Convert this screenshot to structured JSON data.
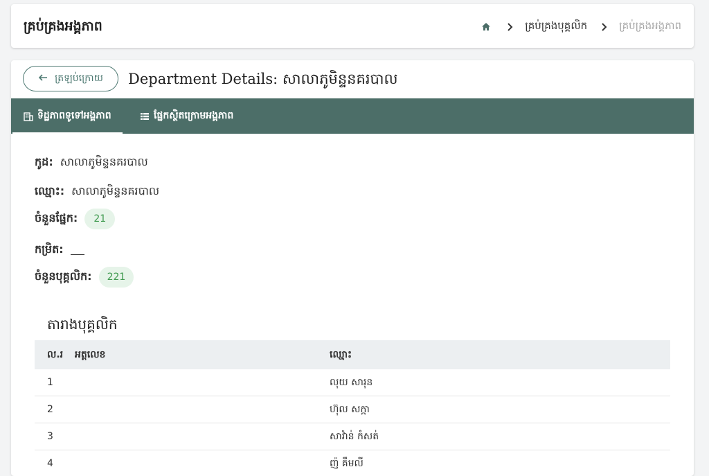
{
  "header": {
    "title": "គ្រប់គ្រងអង្គភាព",
    "breadcrumb": {
      "link": "គ្រប់គ្រងបុគ្គលិក",
      "current": "គ្រប់គ្រងអង្គភាព"
    }
  },
  "page": {
    "back_label": "ត្រឡប់ក្រោយ",
    "title": "Department Details: សាលាភូមិន្ទនគរបាល"
  },
  "tabs": [
    {
      "label": "ទិដ្ឋភាពទូទៅអង្គភាព",
      "icon": "building-icon",
      "active": true
    },
    {
      "label": "ផ្នែកស្ថិតក្រោមអង្គភាព",
      "icon": "list-icon",
      "active": false
    }
  ],
  "details": {
    "code_label": "កូដ:",
    "code_value": "សាលាភូមិន្ទនគរបាល",
    "name_label": "ឈ្មោះ:",
    "name_value": "សាលាភូមិន្ទនគរបាល",
    "sections_label": "ចំនួនផ្នែក:",
    "sections_value": "21",
    "level_label": "កម្រិត:",
    "staff_label": "ចំនួនបុគ្គលិក:",
    "staff_value": "221"
  },
  "staff_table": {
    "title": "តារាងបុគ្គលិក",
    "columns": [
      "ល.រ",
      "អត្តលេខ",
      "ឈ្មោះ"
    ],
    "rows": [
      {
        "no": "1",
        "id": "",
        "name": "លុយ សារុន"
      },
      {
        "no": "2",
        "id": "",
        "name": "ហ៊ុល សក្កា"
      },
      {
        "no": "3",
        "id": "",
        "name": "សាវ៉ាន់ កំសត់"
      },
      {
        "no": "4",
        "id": "",
        "name": "ញ៉ គឹមលី"
      }
    ]
  },
  "colors": {
    "accent": "#4c6e68",
    "pill_bg": "#e6f4e9",
    "pill_text": "#3f9a4f"
  }
}
